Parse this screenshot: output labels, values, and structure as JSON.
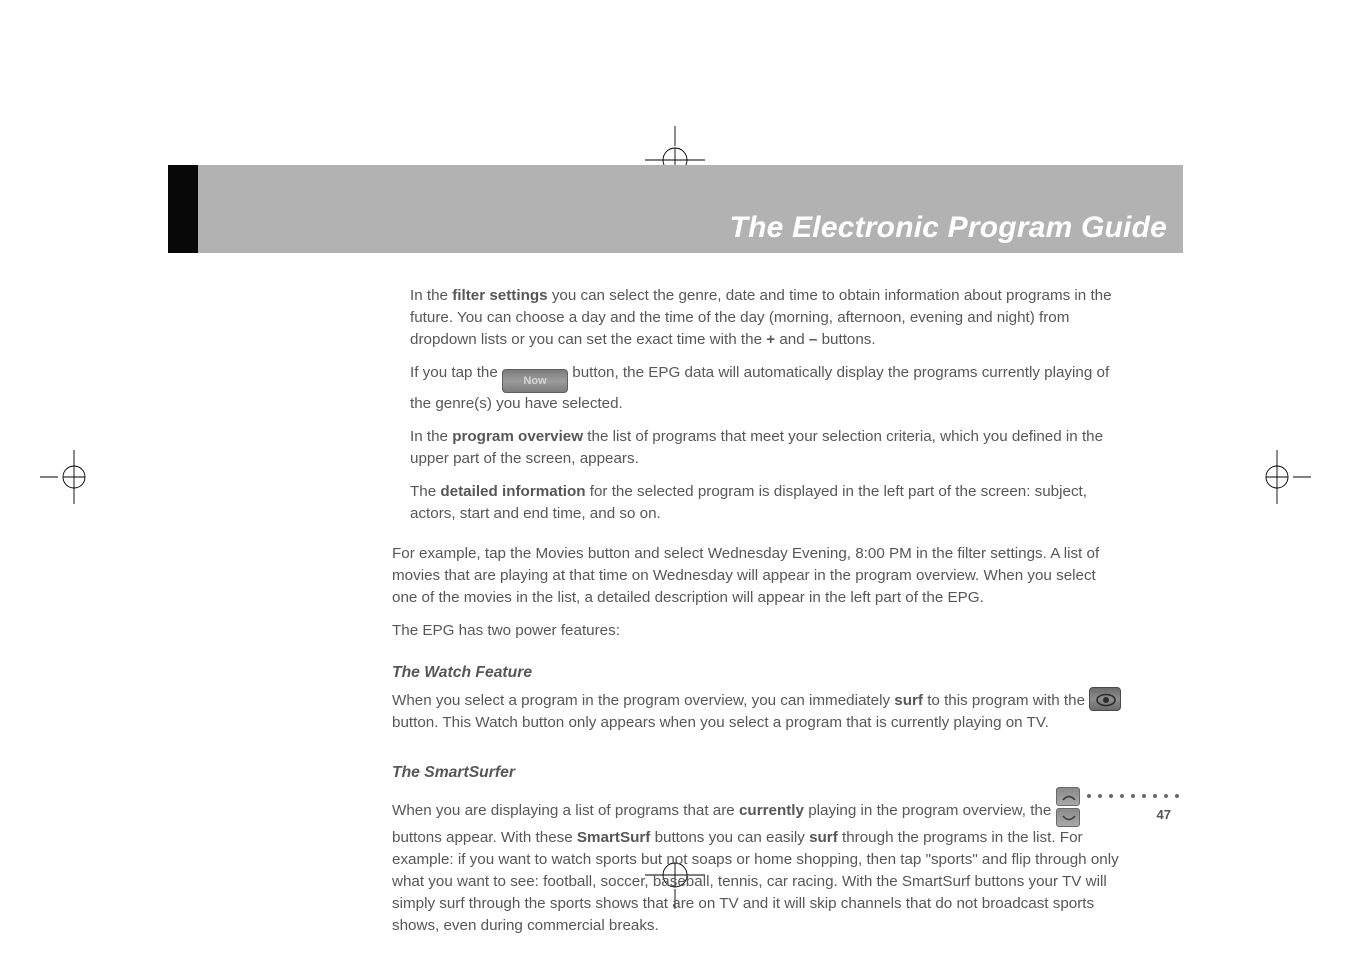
{
  "header": {
    "title": "The Electronic Program Guide"
  },
  "body": {
    "p1_a": "In the ",
    "p1_b": "filter settings",
    "p1_c": " you can select the genre, date and time to obtain information about programs in the future. You can choose a day and the time of the day (morning, afternoon, evening and night) from dropdown lists or you can set the exact time with the ",
    "p1_d": "+",
    "p1_e": " and ",
    "p1_f": "–",
    "p1_g": " buttons.",
    "p2_a": "If you tap the ",
    "now_label": "Now",
    "p2_b": " button, the EPG data will automatically display the programs currently playing of the genre(s) you have selected.",
    "p3_a": "In the ",
    "p3_b": "program overview",
    "p3_c": " the list of programs that meet your selection criteria, which you defined in the upper part of the screen, appears.",
    "p4_a": "The ",
    "p4_b": "detailed information",
    "p4_c": " for the selected program is displayed in the left part of the screen: subject, actors, start and end time, and so on.",
    "p5": "For example, tap the Movies button and select Wednesday Evening, 8:00 PM in the filter settings. A list of movies that are playing at that time on Wednesday will appear in the program overview. When you select one of the movies in the list, a detailed description will appear in the left part of the EPG.",
    "p6": "The EPG has two power features:",
    "watch_head": "The Watch Feature",
    "p7_a": "When you select a program in the program overview, you can immediately ",
    "p7_b": "surf",
    "p7_c": " to this program with the ",
    "p7_d": " button. This Watch button only appears when you select a program that is currently playing on TV.",
    "surfer_head": "The SmartSurfer",
    "p8_a": "When you are displaying a list of programs that are ",
    "p8_b": "currently",
    "p8_c": " playing in the program overview, the ",
    "p8_d": " buttons appear. With these ",
    "p8_e": "SmartSurf",
    "p8_f": " buttons you can easily ",
    "p8_g": "surf",
    "p8_h": " through the programs in the list. For example: if you want to watch sports but not soaps or home shopping, then tap \"sports\" and flip through only what you want to see: football, soccer, baseball, tennis, car racing. With the SmartSurf buttons your TV will simply surf through the sports shows that are on TV and it will skip channels that do not broadcast sports shows, even during commercial breaks."
  },
  "page_number": "47"
}
